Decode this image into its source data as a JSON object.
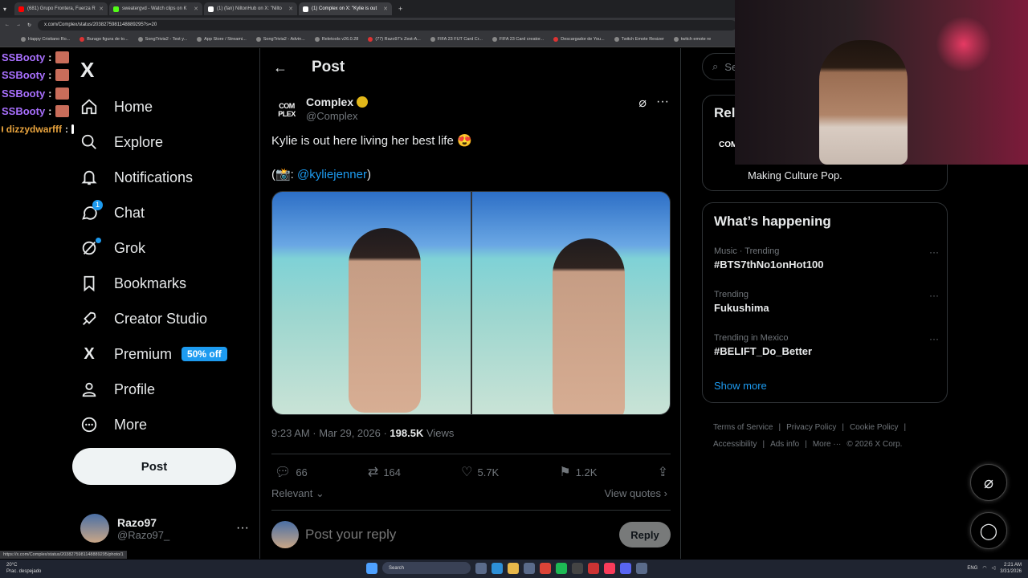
{
  "browser": {
    "tabs": [
      {
        "label": "(681) Grupo Frontera, Fuerza R",
        "color": "#ff0000"
      },
      {
        "label": "sweatergvd - Watch clips on K",
        "color": "#53fc18"
      },
      {
        "label": "(1) (fan) NiltonHub on X: \"Nilto",
        "color": "#ffffff"
      },
      {
        "label": "(1) Complex on X: \"Kylie is out",
        "color": "#ffffff"
      }
    ],
    "url": "x.com/Complex/status/2038275981148889295?s=20",
    "bookmarks": [
      "Happy Cristiano Ro...",
      "Burago figura de to...",
      "SongTrivia2 - Test y...",
      "App Store / Streami...",
      "SongTrivia2 - Advin...",
      "Reletools v26.0.28",
      "(77) Razo97's Zest-A...",
      "FIFA 23 FUT Card Cr...",
      "FIFA 23 Card creator...",
      "Descargador de You...",
      "Twitch Emote Resizer",
      "twitch emote re"
    ],
    "status_url": "https://x.com/Complex/status/2038275981148889295/photo/1"
  },
  "chat": [
    {
      "name": "SSBooty",
      "sep": ":"
    },
    {
      "name": "SSBooty",
      "sep": ":"
    },
    {
      "name": "SSBooty",
      "sep": ":"
    },
    {
      "name": "SSBooty",
      "sep": ":"
    },
    {
      "name": "dizzydwarfff",
      "sep": ":"
    }
  ],
  "sidebar": {
    "logo": "X",
    "items": [
      {
        "label": "Home",
        "icon": "home-icon"
      },
      {
        "label": "Explore",
        "icon": "search-icon"
      },
      {
        "label": "Notifications",
        "icon": "bell-icon"
      },
      {
        "label": "Chat",
        "icon": "chat-icon",
        "badge": "1"
      },
      {
        "label": "Grok",
        "icon": "grok-icon"
      },
      {
        "label": "Bookmarks",
        "icon": "bookmark-icon"
      },
      {
        "label": "Creator Studio",
        "icon": "rocket-icon"
      },
      {
        "label": "Premium",
        "icon": "x-icon",
        "badge": "50% off"
      },
      {
        "label": "Profile",
        "icon": "person-icon"
      },
      {
        "label": "More",
        "icon": "more-circle-icon"
      }
    ],
    "post_button": "Post",
    "account": {
      "name": "Razo97",
      "handle": "@Razo97_"
    }
  },
  "post": {
    "header": "Post",
    "avatar_text": "COM PLEX",
    "author": "Complex",
    "handle": "@Complex",
    "text": "Kylie is out here living her best life 😍",
    "credit_prefix": "(📸: ",
    "mention": "@kyliejenner",
    "credit_suffix": ")",
    "timestamp": "9:23 AM · Mar 29, 2026 · ",
    "views_count": "198.5K",
    "views_label": " Views",
    "stats": {
      "replies": "66",
      "reposts": "164",
      "likes": "5.7K",
      "bookmarks": "1.2K"
    },
    "sort_label": "Relevant",
    "quotes_label": "View quotes",
    "reply_placeholder": "Post your reply",
    "reply_button": "Reply"
  },
  "right": {
    "search_placeholder": "Se",
    "relevant_title": "Rel",
    "relevant_logo": "COM",
    "relevant_bio": "Making Culture Pop.",
    "whats_happening": "What’s happening",
    "trends": [
      {
        "category": "Music · Trending",
        "tag": "#BTS7thNo1onHot100"
      },
      {
        "category": "Trending",
        "tag": "Fukushima"
      },
      {
        "category": "Trending in Mexico",
        "tag": "#BELIFT_Do_Better"
      }
    ],
    "show_more": "Show more",
    "footer": [
      "Terms of Service",
      "|",
      "Privacy Policy",
      "|",
      "Cookie Policy",
      "|",
      "Accessibility",
      "|",
      "Ads info",
      "|",
      "More ···",
      "© 2026 X Corp."
    ]
  },
  "taskbar": {
    "weather_temp": "20°C",
    "weather_desc": "Prac. despejado",
    "search": "Search",
    "lang": "ENG",
    "time": "2:21 AM",
    "date": "3/31/2026"
  },
  "colors": {
    "accent": "#1d9bf0",
    "verified": "#e2b719",
    "chat_name": "#a970ff"
  }
}
